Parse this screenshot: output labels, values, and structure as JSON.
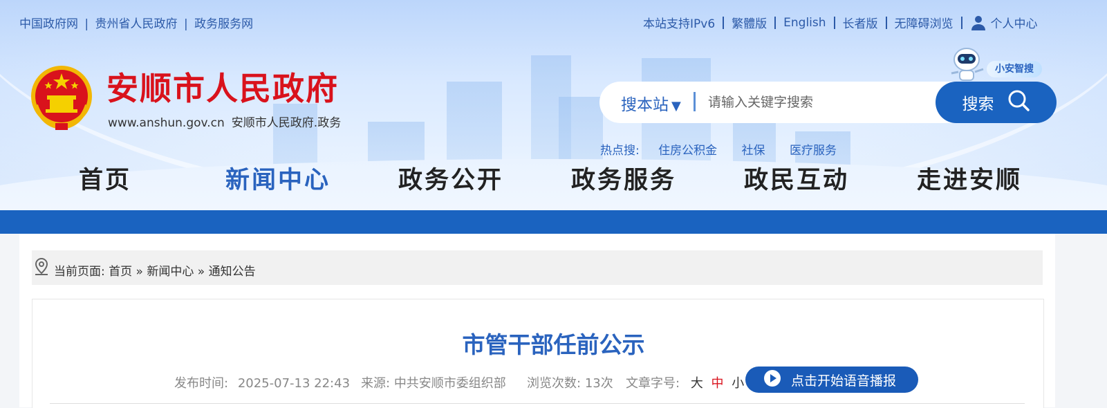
{
  "top_links": {
    "gov": "中国政府网",
    "province": "贵州省人民政府",
    "service": "政务服务网",
    "sep": "|"
  },
  "right_links": {
    "ipv6": "本站支持IPv6",
    "traditional": "繁體版",
    "english": "English",
    "elder": "长者版",
    "accessible": "无障碍浏览",
    "personal": "个人中心"
  },
  "site": {
    "title": "安顺市人民政府",
    "url": "www.anshun.gov.cn",
    "domain_suffix": "安顺市人民政府.政务"
  },
  "search": {
    "scope": "搜本站",
    "scope_arrow": "▼",
    "placeholder": "请输入关键字搜索",
    "button": "搜索",
    "assistant": "小安智搜"
  },
  "hot": {
    "label": "热点搜:",
    "items": [
      "住房公积金",
      "社保",
      "医疗服务"
    ]
  },
  "nav": {
    "items": [
      "首页",
      "新闻中心",
      "政务公开",
      "政务服务",
      "政民互动",
      "走进安顺"
    ],
    "active_index": 1
  },
  "breadcrumb": {
    "label": "当前页面:",
    "items": [
      "首页",
      "新闻中心",
      "通知公告"
    ],
    "sep": "»"
  },
  "article": {
    "title": "市管干部任前公示",
    "publish_label": "发布时间:",
    "publish_time": "2025-07-13 22:43",
    "source_label": "来源:",
    "source": "中共安顺市委组织部",
    "views_label": "浏览次数:",
    "views": "13次",
    "fontsize_label": "文章字号:",
    "size_large": "大",
    "size_medium": "中",
    "size_small": "小",
    "voice_button": "点击开始语音播报"
  },
  "colors": {
    "primary": "#1a63c0",
    "link": "#2a63be",
    "title_red": "#d9121c"
  }
}
